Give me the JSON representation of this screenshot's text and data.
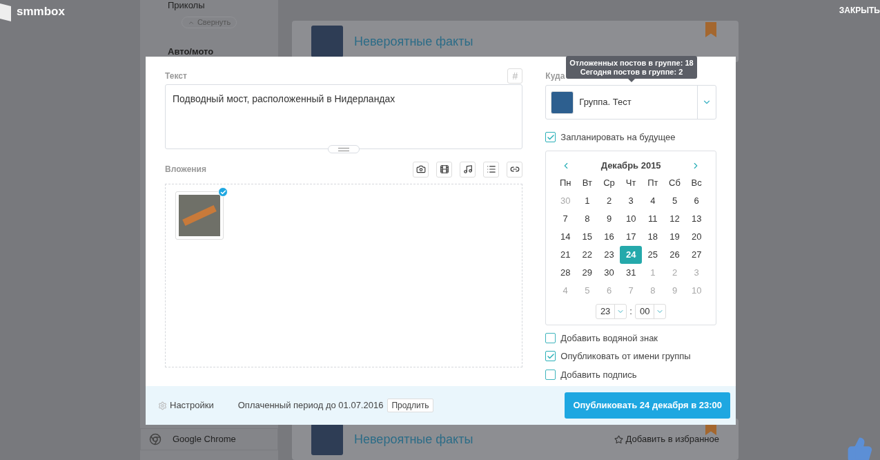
{
  "app": {
    "logo": "smmbox",
    "close": "ЗАКРЫТЬ"
  },
  "sidebar": {
    "items_top": [
      {
        "label": "Приколы"
      }
    ],
    "collapse": "Свернуть",
    "items": [
      {
        "label": "Авто/мото"
      }
    ],
    "browser": "Google Chrome"
  },
  "feed": [
    {
      "title": "Невероятные факты"
    },
    {
      "title": "Невероятные факты",
      "favorite": "Добавить в избранное"
    }
  ],
  "dialog": {
    "text_label": "Текст",
    "hashtag": "#",
    "text_value": "Подводный мост, расположенный в Нидерландах",
    "attachments_label": "Вложения",
    "target_label": "Куда",
    "tooltip": [
      "Отложенных постов в группе: 18",
      "Сегодня постов в группе: 2"
    ],
    "group": "Группа. Тест",
    "schedule": {
      "label": "Запланировать на будущее",
      "checked": true
    },
    "calendar": {
      "month": "Декабрь 2015",
      "weekdays": [
        "Пн",
        "Вт",
        "Ср",
        "Чт",
        "Пт",
        "Сб",
        "Вс"
      ],
      "days": [
        {
          "day": "30",
          "muted": true,
          "selected": false
        },
        {
          "day": "1",
          "muted": false,
          "selected": false
        },
        {
          "day": "2",
          "muted": false,
          "selected": false
        },
        {
          "day": "3",
          "muted": false,
          "selected": false
        },
        {
          "day": "4",
          "muted": false,
          "selected": false
        },
        {
          "day": "5",
          "muted": false,
          "selected": false
        },
        {
          "day": "6",
          "muted": false,
          "selected": false
        },
        {
          "day": "7",
          "muted": false,
          "selected": false
        },
        {
          "day": "8",
          "muted": false,
          "selected": false
        },
        {
          "day": "9",
          "muted": false,
          "selected": false
        },
        {
          "day": "10",
          "muted": false,
          "selected": false
        },
        {
          "day": "11",
          "muted": false,
          "selected": false
        },
        {
          "day": "12",
          "muted": false,
          "selected": false
        },
        {
          "day": "13",
          "muted": false,
          "selected": false
        },
        {
          "day": "14",
          "muted": false,
          "selected": false
        },
        {
          "day": "15",
          "muted": false,
          "selected": false
        },
        {
          "day": "16",
          "muted": false,
          "selected": false
        },
        {
          "day": "17",
          "muted": false,
          "selected": false
        },
        {
          "day": "18",
          "muted": false,
          "selected": false
        },
        {
          "day": "19",
          "muted": false,
          "selected": false
        },
        {
          "day": "20",
          "muted": false,
          "selected": false
        },
        {
          "day": "21",
          "muted": false,
          "selected": false
        },
        {
          "day": "22",
          "muted": false,
          "selected": false
        },
        {
          "day": "23",
          "muted": false,
          "selected": false
        },
        {
          "day": "24",
          "muted": false,
          "selected": true
        },
        {
          "day": "25",
          "muted": false,
          "selected": false
        },
        {
          "day": "26",
          "muted": false,
          "selected": false
        },
        {
          "day": "27",
          "muted": false,
          "selected": false
        },
        {
          "day": "28",
          "muted": false,
          "selected": false
        },
        {
          "day": "29",
          "muted": false,
          "selected": false
        },
        {
          "day": "30",
          "muted": false,
          "selected": false
        },
        {
          "day": "31",
          "muted": false,
          "selected": false
        },
        {
          "day": "1",
          "muted": true,
          "selected": false
        },
        {
          "day": "2",
          "muted": true,
          "selected": false
        },
        {
          "day": "3",
          "muted": true,
          "selected": false
        },
        {
          "day": "4",
          "muted": true,
          "selected": false
        },
        {
          "day": "5",
          "muted": true,
          "selected": false
        },
        {
          "day": "6",
          "muted": true,
          "selected": false
        },
        {
          "day": "7",
          "muted": true,
          "selected": false
        },
        {
          "day": "8",
          "muted": true,
          "selected": false
        },
        {
          "day": "9",
          "muted": true,
          "selected": false
        },
        {
          "day": "10",
          "muted": true,
          "selected": false
        }
      ],
      "hour": "23",
      "separator": ":",
      "minute": "00"
    },
    "options": [
      {
        "label": "Добавить водяной знак",
        "checked": false
      },
      {
        "label": "Опубликовать от имени группы",
        "checked": true
      },
      {
        "label": "Добавить подпись",
        "checked": false
      }
    ],
    "footer": {
      "settings": "Настройки",
      "period": "Оплаченный период до 01.07.2016",
      "extend": "Продлить",
      "publish": "Опубликовать 24 декабря в 23:00"
    }
  }
}
